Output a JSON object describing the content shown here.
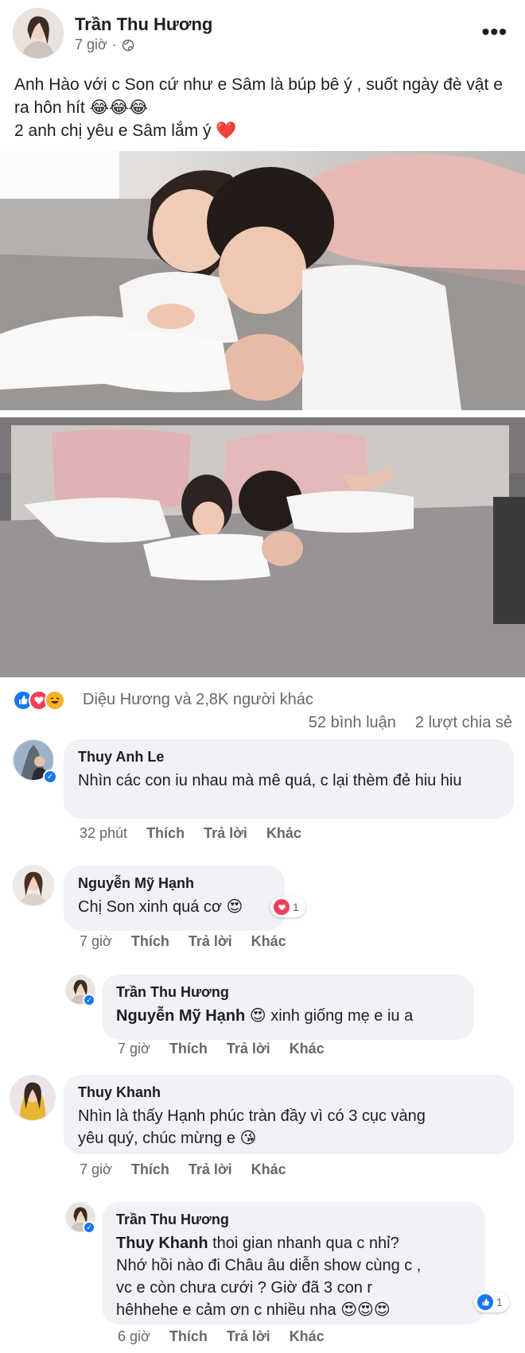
{
  "post": {
    "author": "Trần Thu Hương",
    "time": "7 giờ",
    "privacy_icon": "globe-icon",
    "caption_line1": "Anh Hào với c Son cứ như e Sâm là búp bê ý , suốt ngày đè vật e ra hôn hít 😂😂😂",
    "caption_line2": "2 anh chị yêu e Sâm lắm ý ❤️"
  },
  "reactions": {
    "icons": [
      "like-icon",
      "love-icon",
      "haha-icon"
    ],
    "summary": "Diệu Hương và 2,8K người khác",
    "comments_count": "52 bình luận",
    "shares_count": "2 lượt chia sẻ",
    "colors": {
      "like": "#1877f2",
      "love": "#f33e58",
      "haha": "#f7b125"
    }
  },
  "comments": [
    {
      "name": "Thuy Anh Le",
      "text": "Nhìn các con iu nhau mà mê quá, c lại thèm đẻ hiu hiu",
      "time": "32 phút",
      "like": "Thích",
      "reply": "Trả lời",
      "more": "Khác"
    },
    {
      "name": "Nguyễn Mỹ Hạnh",
      "text": "Chị Son xinh quá cơ 😍",
      "reaction_count": "1",
      "time": "7 giờ",
      "like": "Thích",
      "reply": "Trả lời",
      "more": "Khác",
      "replies": [
        {
          "name": "Trần Thu Hương",
          "mention": "Nguyễn Mỹ Hạnh",
          "text": " 😍 xinh giống mẹ e iu a",
          "time": "7 giờ",
          "like": "Thích",
          "reply": "Trả lời",
          "more": "Khác"
        }
      ]
    },
    {
      "name": "Thuy Khanh",
      "text_line1": "Nhìn là thấy Hạnh phúc tràn đầy vì có 3 cục vàng",
      "text_line2": "yêu quý, chúc mừng e 😘",
      "time": "7 giờ",
      "like": "Thích",
      "reply": "Trả lời",
      "more": "Khác",
      "replies": [
        {
          "name": "Trần Thu Hương",
          "mention": "Thuy Khanh",
          "text_line1": " thoi gian nhanh qua c nhỉ?",
          "text_line2": "Nhớ hồi nào đi Châu âu diễn show cùng c ,",
          "text_line3": "vc e còn chưa cưới ? Giờ đã 3 con r",
          "text_line4": "hêhhehe e cảm ơn c nhiều nha 😍😍😍",
          "reaction_count": "1",
          "time": "6 giờ",
          "like": "Thích",
          "reply": "Trả lời",
          "more": "Khác"
        }
      ]
    }
  ]
}
